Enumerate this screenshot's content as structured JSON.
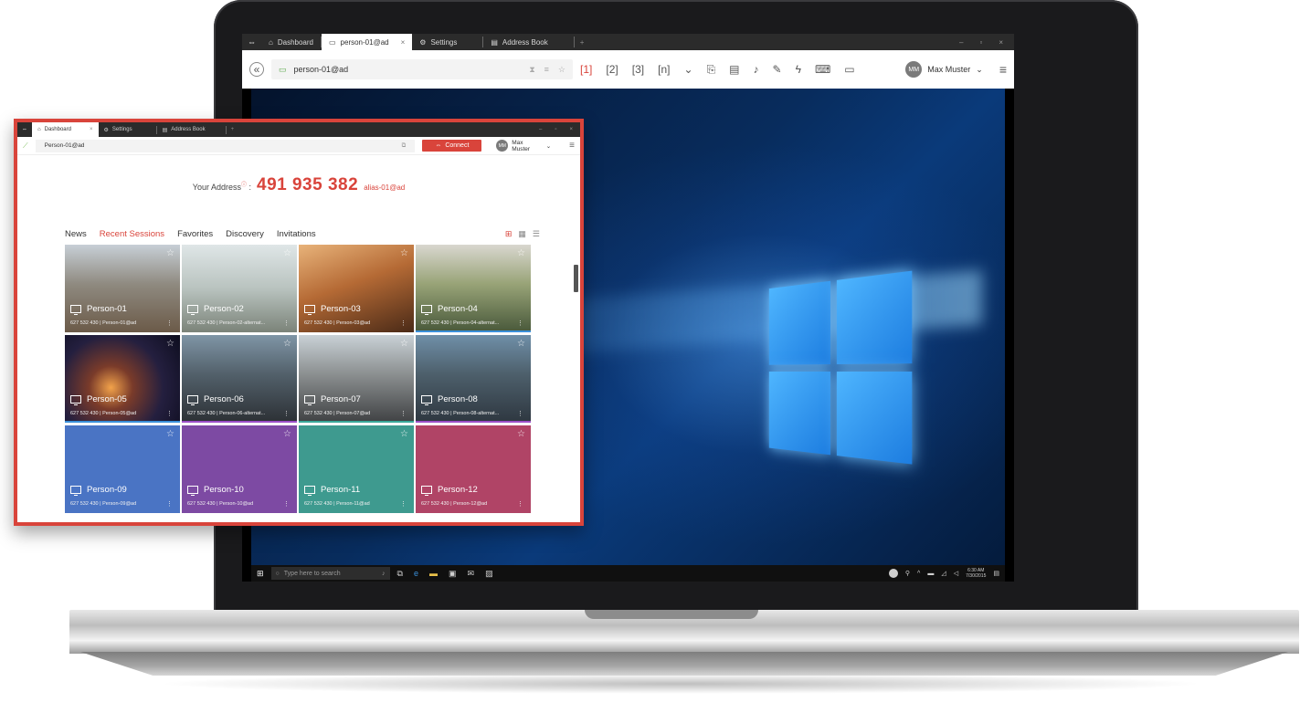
{
  "remote": {
    "tabs": [
      {
        "label": "Dashboard",
        "icon": "home-icon"
      },
      {
        "label": "person-01@ad",
        "icon": "monitor-icon",
        "active": true
      },
      {
        "label": "Settings",
        "icon": "gear-icon"
      },
      {
        "label": "Address Book",
        "icon": "book-icon"
      }
    ],
    "address": "person-01@ad",
    "user": {
      "initials": "MM",
      "name": "Max Muster"
    },
    "session_tools": [
      "1",
      "2",
      "3",
      "n"
    ],
    "taskbar": {
      "search_placeholder": "Type here to search",
      "time": "6:30 AM",
      "date": "7/30/2015"
    }
  },
  "dashboard": {
    "tabs": [
      {
        "label": "Dashboard",
        "icon": "home-icon",
        "active": true
      },
      {
        "label": "Settings",
        "icon": "gear-icon"
      },
      {
        "label": "Address Book",
        "icon": "book-icon"
      }
    ],
    "address_input": "Person-01@ad",
    "connect_label": "Connect",
    "user": {
      "initials": "MM",
      "name": "Max Muster"
    },
    "your_address_label": "Your Address",
    "your_address_number": "491 935 382",
    "alias": "alias-01@ad",
    "nav": [
      "News",
      "Recent Sessions",
      "Favorites",
      "Discovery",
      "Invitations"
    ],
    "active_nav": "Recent Sessions",
    "sessions": [
      {
        "name": "Person-01",
        "meta": "627 532 430 | Person-01@ad",
        "bg": "linear-gradient(180deg,#c7cfd6 0%,#8f8a80 45%,#6b5a48 100%)",
        "underline": ""
      },
      {
        "name": "Person-02",
        "meta": "627 532 430 | Person-02-alternat...",
        "bg": "linear-gradient(180deg,#dfe6e7 0%,#b9c3bf 50%,#7b8379 100%)",
        "underline": ""
      },
      {
        "name": "Person-03",
        "meta": "627 532 430 | Person-03@ad",
        "bg": "linear-gradient(160deg,#e8b37a 0%,#b56a35 45%,#4a2a17 100%)",
        "underline": ""
      },
      {
        "name": "Person-04",
        "meta": "627 532 430 | Person-04-alternat...",
        "bg": "linear-gradient(180deg,#d9d7cf 0%,#98a377 45%,#48583a 100%)",
        "underline": "#3a8fd9"
      },
      {
        "name": "Person-05",
        "meta": "627 532 430 | Person-05@ad",
        "bg": "radial-gradient(circle at 40% 60%,#f2a24a 0%,#7a3b2a 25%,#241f3f 60%,#0d0d1e 100%)",
        "underline": "#3a8fd9"
      },
      {
        "name": "Person-06",
        "meta": "627 532 430 | Person-06-alternat...",
        "bg": "linear-gradient(180deg,#7f95a6 0%,#52606a 45%,#2c3035 100%)",
        "underline": "#9c4fc7"
      },
      {
        "name": "Person-07",
        "meta": "627 532 430 | Person-07@ad",
        "bg": "linear-gradient(180deg,#c9d1d6 0%,#8b8f90 45%,#3f4143 100%)",
        "underline": "#3aa89a"
      },
      {
        "name": "Person-08",
        "meta": "627 532 430 | Person-08-alternat...",
        "bg": "linear-gradient(180deg,#6f8fa8 0%,#4d5f6b 45%,#2e3740 100%)",
        "underline": "#9c4fc7"
      },
      {
        "name": "Person-09",
        "meta": "627 532 430 | Person-09@ad",
        "bg": "#4a74c4",
        "underline": ""
      },
      {
        "name": "Person-10",
        "meta": "627 532 430 | Person-10@ad",
        "bg": "#7d4aa3",
        "underline": ""
      },
      {
        "name": "Person-11",
        "meta": "627 532 430 | Person-11@ad",
        "bg": "#3e9a8f",
        "underline": ""
      },
      {
        "name": "Person-12",
        "meta": "627 532 430 | Person-12@ad",
        "bg": "#b04466",
        "underline": ""
      }
    ]
  },
  "colors": {
    "accent": "#d9443b",
    "dark_bar": "#2b2b2b"
  }
}
